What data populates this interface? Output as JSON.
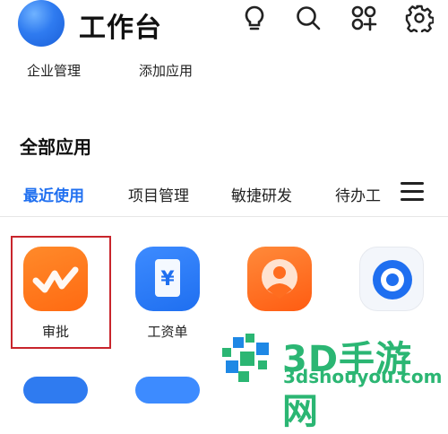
{
  "header": {
    "title": "工作台"
  },
  "quick_links": [
    {
      "label": "企业管理"
    },
    {
      "label": "添加应用"
    }
  ],
  "section_title": "全部应用",
  "tabs": [
    {
      "label": "最近使用",
      "active": true
    },
    {
      "label": "项目管理"
    },
    {
      "label": "敏捷研发"
    },
    {
      "label": "待办工"
    }
  ],
  "apps": [
    {
      "label": "审批",
      "icon": "approval-icon",
      "color": "#ff7a1a"
    },
    {
      "label": "工资单",
      "icon": "payroll-icon",
      "color": "#2f7bf0"
    },
    {
      "label": "",
      "icon": "person-location-icon",
      "color": "#ff6d1f"
    },
    {
      "label": "",
      "icon": "ring-icon",
      "color": "#1f6ff0"
    }
  ],
  "watermark": {
    "text": "3D手游网",
    "url": "3dshouyou.com"
  },
  "colors": {
    "accent": "#1f6ff0",
    "highlight": "#c8252c",
    "watermark": "#2bb673"
  }
}
